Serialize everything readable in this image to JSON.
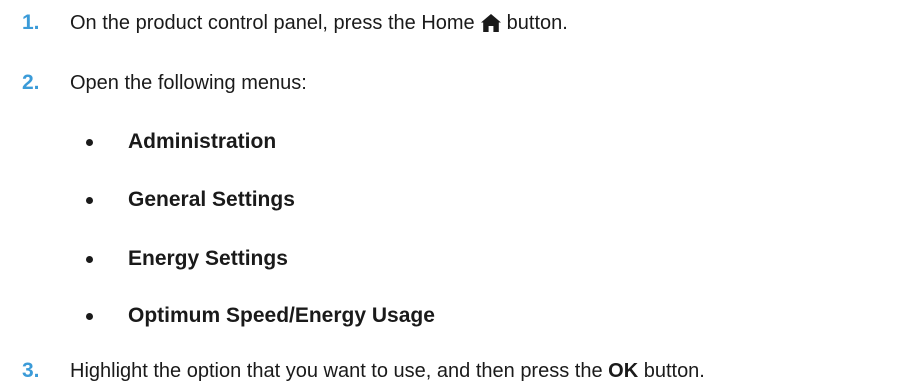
{
  "steps": [
    {
      "number": "1.",
      "text_before": "On the product control panel, press the Home",
      "icon": "home-icon",
      "text_after": "button."
    },
    {
      "number": "2.",
      "text": "Open the following menus:"
    },
    {
      "number": "3.",
      "text_before": "Highlight the option that you want to use, and then press the",
      "button_label": "OK",
      "text_after": "button."
    }
  ],
  "menu_items": [
    "Administration",
    "General Settings",
    "Energy Settings",
    "Optimum Speed/Energy Usage"
  ],
  "colors": {
    "step_number": "#3b9bd8",
    "text": "#1a1a1a"
  }
}
